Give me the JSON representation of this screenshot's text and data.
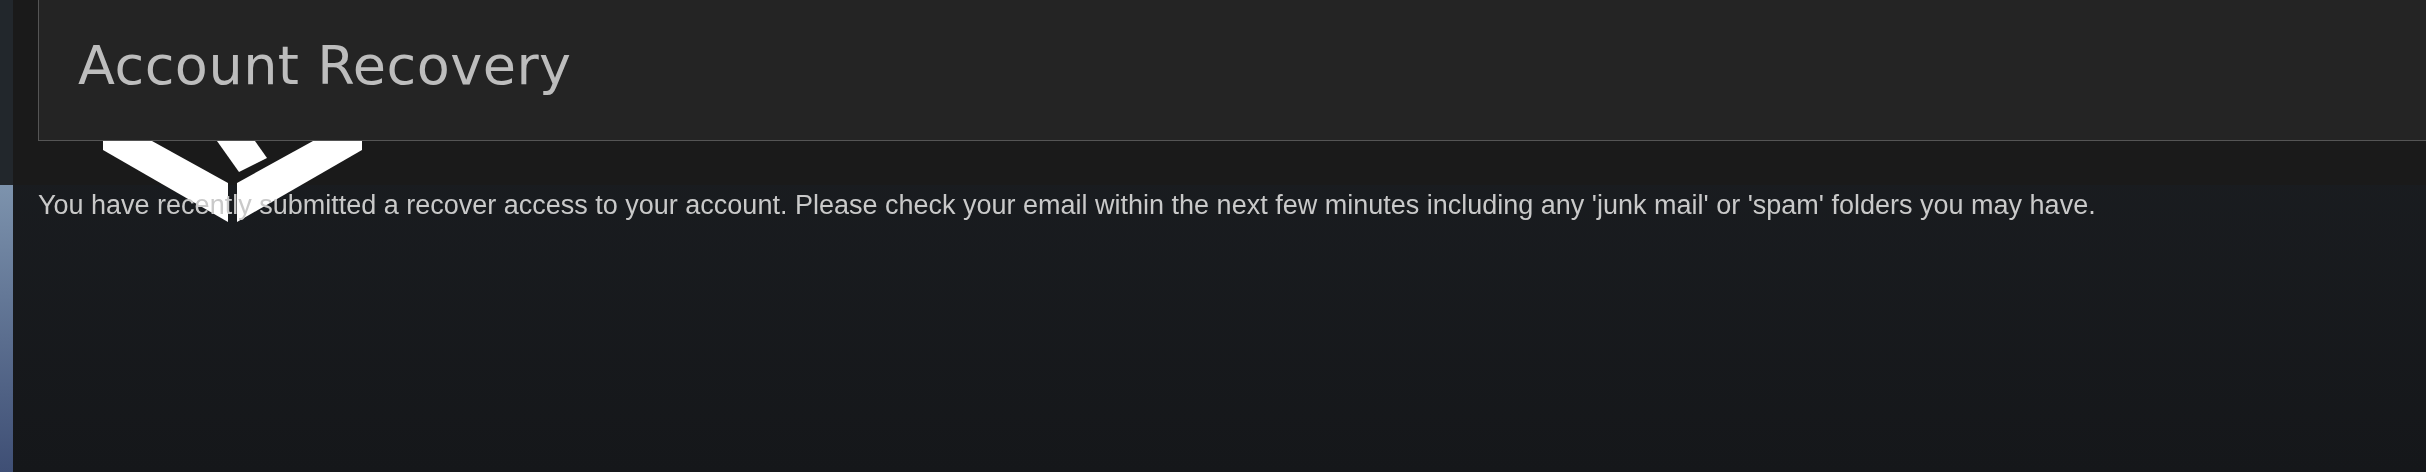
{
  "header": {
    "title": "Account Recovery"
  },
  "message": "You have recently submitted a recover access to your account. Please check your email within the next few minutes including any 'junk mail' or 'spam' folders you may have."
}
